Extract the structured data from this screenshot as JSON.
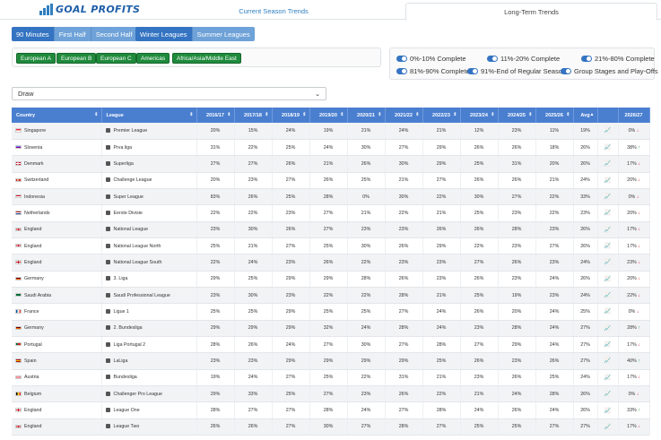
{
  "brand": {
    "logo_text": "GOAL PROFITS",
    "bar_color": "#2f7fc1"
  },
  "tabs": [
    {
      "label": "Current Season Trends"
    },
    {
      "label": "Long-Term Trends"
    }
  ],
  "time_buttons": [
    {
      "label": "90 Minutes"
    },
    {
      "label": "First Half"
    },
    {
      "label": "Second Half"
    }
  ],
  "league_buttons": [
    {
      "label": "Winter Leagues"
    },
    {
      "label": "Summer Leagues"
    }
  ],
  "regions": [
    {
      "label": "European A"
    },
    {
      "label": "European B"
    },
    {
      "label": "European C"
    },
    {
      "label": "Americas"
    },
    {
      "label": "Africa/Asia/Middle East"
    }
  ],
  "toggles": [
    {
      "label": "0%-10% Complete"
    },
    {
      "label": "11%-20% Complete"
    },
    {
      "label": "21%-80% Complete"
    },
    {
      "label": "81%-90% Complete"
    },
    {
      "label": "91%-End of Regular Season"
    },
    {
      "label": "Group Stages and Play-Offs"
    }
  ],
  "market_select": {
    "value": "Draw"
  },
  "table": {
    "headers": [
      "Country",
      "League",
      "2016/17",
      "2017/18",
      "2018/19",
      "2019/20",
      "2020/21",
      "2021/22",
      "2022/23",
      "2023/24",
      "2024/25",
      "2025/26",
      "Avg",
      "",
      "2026/27"
    ],
    "rows": [
      {
        "country": "Singapore",
        "league": "Premier League",
        "vals": [
          "20%",
          "15%",
          "24%",
          "19%",
          "21%",
          "24%",
          "21%",
          "12%",
          "23%",
          "11%",
          "19%"
        ],
        "cur": "0%",
        "dir": "down"
      },
      {
        "country": "Slovenia",
        "league": "Prva liga",
        "vals": [
          "31%",
          "22%",
          "25%",
          "24%",
          "30%",
          "27%",
          "29%",
          "26%",
          "26%",
          "18%",
          "26%"
        ],
        "cur": "38%",
        "dir": "up"
      },
      {
        "country": "Denmark",
        "league": "Superliga",
        "vals": [
          "27%",
          "27%",
          "26%",
          "21%",
          "26%",
          "30%",
          "29%",
          "25%",
          "31%",
          "20%",
          "26%"
        ],
        "cur": "17%",
        "dir": "down"
      },
      {
        "country": "Switzerland",
        "league": "Challenge League",
        "vals": [
          "20%",
          "23%",
          "27%",
          "26%",
          "25%",
          "21%",
          "27%",
          "26%",
          "26%",
          "21%",
          "24%"
        ],
        "cur": "20%",
        "dir": "down"
      },
      {
        "country": "Indonesia",
        "league": "Super League",
        "vals": [
          "83%",
          "26%",
          "25%",
          "28%",
          "0%",
          "30%",
          "22%",
          "30%",
          "27%",
          "22%",
          "33%"
        ],
        "cur": "0%",
        "dir": "down"
      },
      {
        "country": "Netherlands",
        "league": "Eerste Divisie",
        "vals": [
          "22%",
          "22%",
          "23%",
          "27%",
          "21%",
          "22%",
          "21%",
          "25%",
          "23%",
          "22%",
          "23%"
        ],
        "cur": "20%",
        "dir": "down"
      },
      {
        "country": "England",
        "league": "National League",
        "vals": [
          "23%",
          "30%",
          "26%",
          "27%",
          "23%",
          "23%",
          "26%",
          "26%",
          "28%",
          "23%",
          "26%"
        ],
        "cur": "17%",
        "dir": "down"
      },
      {
        "country": "England",
        "league": "National League North",
        "vals": [
          "25%",
          "21%",
          "27%",
          "25%",
          "30%",
          "26%",
          "29%",
          "22%",
          "23%",
          "27%",
          "26%"
        ],
        "cur": "17%",
        "dir": "down"
      },
      {
        "country": "England",
        "league": "National League South",
        "vals": [
          "22%",
          "24%",
          "23%",
          "26%",
          "22%",
          "23%",
          "23%",
          "27%",
          "26%",
          "23%",
          "24%"
        ],
        "cur": "23%",
        "dir": "down"
      },
      {
        "country": "Germany",
        "league": "3. Liga",
        "vals": [
          "29%",
          "25%",
          "29%",
          "29%",
          "28%",
          "26%",
          "23%",
          "26%",
          "23%",
          "24%",
          "26%"
        ],
        "cur": "20%",
        "dir": "down"
      },
      {
        "country": "Saudi Arabia",
        "league": "Saudi Professional League",
        "vals": [
          "23%",
          "30%",
          "23%",
          "22%",
          "22%",
          "28%",
          "21%",
          "25%",
          "19%",
          "23%",
          "24%"
        ],
        "cur": "22%",
        "dir": "down"
      },
      {
        "country": "France",
        "league": "Ligue 1",
        "vals": [
          "25%",
          "25%",
          "29%",
          "25%",
          "25%",
          "27%",
          "24%",
          "26%",
          "20%",
          "24%",
          "25%"
        ],
        "cur": "0%",
        "dir": "down"
      },
      {
        "country": "Germany",
        "league": "2. Bundesliga",
        "vals": [
          "29%",
          "29%",
          "29%",
          "32%",
          "24%",
          "28%",
          "24%",
          "23%",
          "28%",
          "24%",
          "27%"
        ],
        "cur": "28%",
        "dir": "up"
      },
      {
        "country": "Portugal",
        "league": "Liga Portugal 2",
        "vals": [
          "28%",
          "26%",
          "24%",
          "27%",
          "30%",
          "27%",
          "28%",
          "27%",
          "29%",
          "24%",
          "27%"
        ],
        "cur": "17%",
        "dir": "down"
      },
      {
        "country": "Spain",
        "league": "LaLiga",
        "vals": [
          "23%",
          "23%",
          "29%",
          "29%",
          "29%",
          "29%",
          "25%",
          "26%",
          "23%",
          "26%",
          "27%"
        ],
        "cur": "40%",
        "dir": "up"
      },
      {
        "country": "Austria",
        "league": "Bundesliga",
        "vals": [
          "19%",
          "24%",
          "27%",
          "25%",
          "22%",
          "31%",
          "21%",
          "23%",
          "26%",
          "25%",
          "24%"
        ],
        "cur": "17%",
        "dir": "down"
      },
      {
        "country": "Belgium",
        "league": "Challenger Pro League",
        "vals": [
          "29%",
          "33%",
          "25%",
          "27%",
          "23%",
          "26%",
          "22%",
          "21%",
          "24%",
          "28%",
          "26%"
        ],
        "cur": "0%",
        "dir": "down"
      },
      {
        "country": "England",
        "league": "League One",
        "vals": [
          "28%",
          "27%",
          "27%",
          "28%",
          "24%",
          "27%",
          "28%",
          "24%",
          "26%",
          "24%",
          "26%"
        ],
        "cur": "33%",
        "dir": "up"
      },
      {
        "country": "England",
        "league": "League Two",
        "vals": [
          "26%",
          "26%",
          "27%",
          "30%",
          "27%",
          "28%",
          "27%",
          "25%",
          "25%",
          "27%",
          "27%"
        ],
        "cur": "17%",
        "dir": "down"
      }
    ]
  },
  "flags": {
    "Singapore": [
      "#ef3340",
      "#ffffff"
    ],
    "Slovenia": [
      "#ffffff",
      "#0000ff",
      "#ff0000"
    ],
    "Denmark": [
      "#c8102e"
    ],
    "Switzerland": [
      "#d52b1e"
    ],
    "Indonesia": [
      "#ce1126",
      "#ffffff"
    ],
    "Netherlands": [
      "#ae1c28",
      "#ffffff",
      "#21468b"
    ],
    "England": [
      "#ffffff"
    ],
    "Germany": [
      "#000000",
      "#dd0000",
      "#ffce00"
    ],
    "Saudi Arabia": [
      "#006c35"
    ],
    "France": [
      "#0055a4",
      "#ffffff",
      "#ef4135"
    ],
    "Portugal": [
      "#046a38",
      "#da291c"
    ],
    "Spain": [
      "#aa151b",
      "#f1bf00",
      "#aa151b"
    ],
    "Austria": [
      "#ed2939",
      "#ffffff",
      "#ed2939"
    ],
    "Belgium": [
      "#000000",
      "#fdda24",
      "#ef3340"
    ]
  },
  "colors": {
    "header_bg": "#4a7fd0",
    "region_green": "#1f8a3c",
    "up_arrow": "#1e9a3c",
    "down_arrow": "#d9363e",
    "active_blue": "#3474c2"
  }
}
